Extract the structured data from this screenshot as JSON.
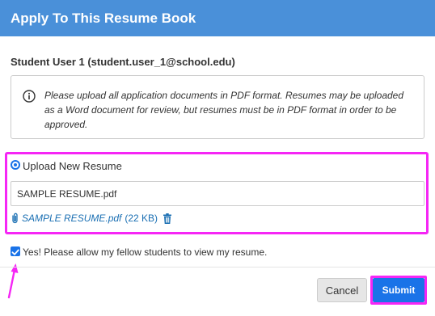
{
  "modal": {
    "title": "Apply To This Resume Book"
  },
  "student": {
    "name_line": "Student User 1 (student.user_1@school.edu)"
  },
  "notice": {
    "icon": "info-icon",
    "text": "Please upload all application documents in PDF format. Resumes may be uploaded as a Word document for review, but resumes must be in PDF format in order to be approved."
  },
  "upload": {
    "option_label": "Upload New Resume",
    "option_selected": true,
    "file_value": "SAMPLE RESUME.pdf",
    "attached_file_name": "SAMPLE RESUME.pdf",
    "attached_file_size": "(22 KB)"
  },
  "share": {
    "label": "Yes! Please allow my fellow students to view my resume.",
    "checked": true
  },
  "footer": {
    "cancel_label": "Cancel",
    "submit_label": "Submit"
  },
  "colors": {
    "header": "#4a90d9",
    "primary": "#1a73e8",
    "link": "#1a6fb3",
    "highlight": "#f526f5"
  }
}
